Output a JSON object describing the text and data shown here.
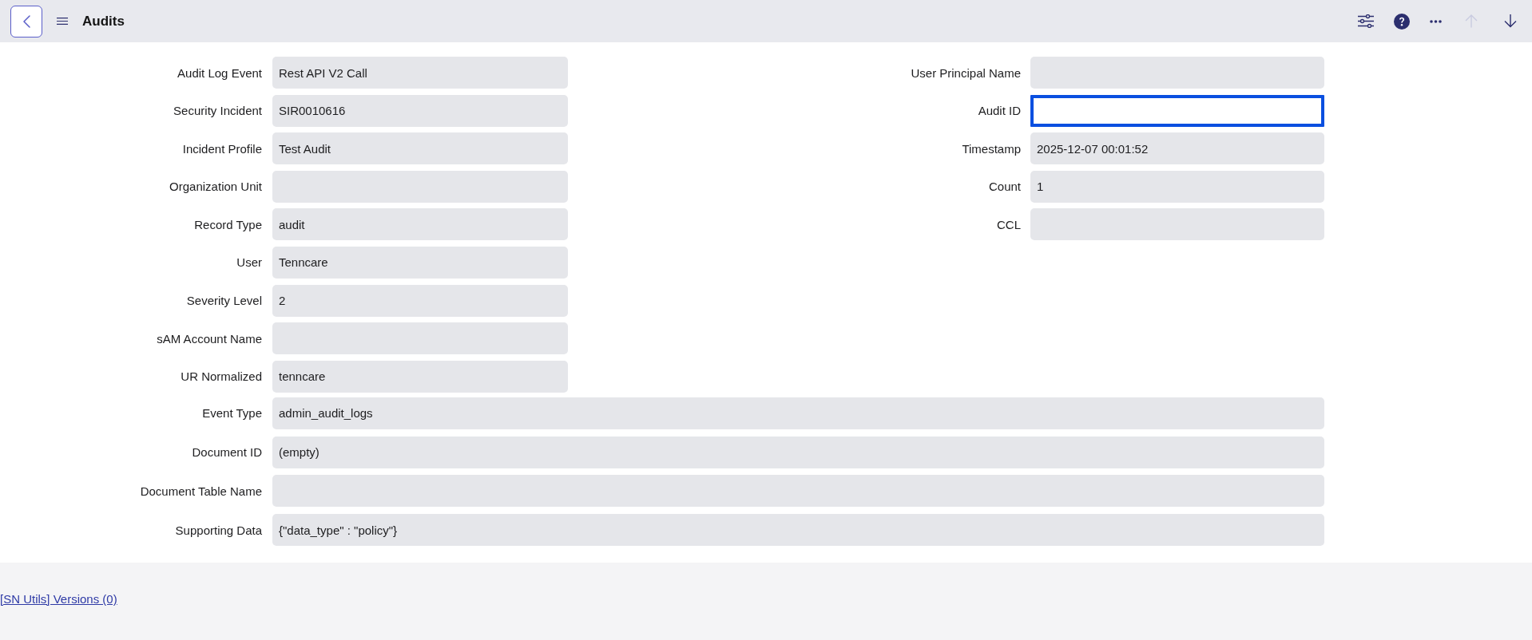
{
  "header": {
    "title": "Audits",
    "nav_buttons": [
      {
        "kind": "up",
        "disabled": true
      },
      {
        "kind": "down",
        "disabled": false
      }
    ]
  },
  "form": {
    "left_fields": [
      {
        "label": "Audit Log Event",
        "value": "Rest API V2 Call",
        "focused": false
      },
      {
        "label": "Security Incident",
        "value": "SIR0010616",
        "focused": false
      },
      {
        "label": "Incident Profile",
        "value": "Test Audit",
        "focused": false
      },
      {
        "label": "Organization Unit",
        "focused": false
      },
      {
        "label": "Record Type",
        "value": "audit",
        "focused": false
      },
      {
        "label": "User",
        "value": "Tenncare",
        "focused": false
      },
      {
        "label": "Severity Level",
        "value": "2",
        "focused": false
      },
      {
        "label": "sAM Account Name",
        "focused": false
      },
      {
        "label": "UR Normalized",
        "value": "tenncare",
        "focused": false
      }
    ],
    "right_fields": [
      {
        "label": "User Principal Name",
        "focused": false
      },
      {
        "label": "Audit ID",
        "focused": true
      },
      {
        "label": "Timestamp",
        "value": "2025-12-07 00:01:52",
        "focused": false
      },
      {
        "label": "Count",
        "value": "1",
        "focused": false
      },
      {
        "label": "CCL",
        "focused": false
      }
    ],
    "wide_fields": [
      {
        "label": "Event Type",
        "value": "admin_audit_logs",
        "focused": false
      },
      {
        "label": "Document ID",
        "value": "(empty)",
        "focused": false
      },
      {
        "label": "Document Table Name",
        "focused": false
      },
      {
        "label": "Supporting Data",
        "value": "{\"data_type\" : \"policy\"}",
        "focused": false
      }
    ]
  },
  "footer": {
    "link": "[SN Utils] Versions (0)"
  }
}
